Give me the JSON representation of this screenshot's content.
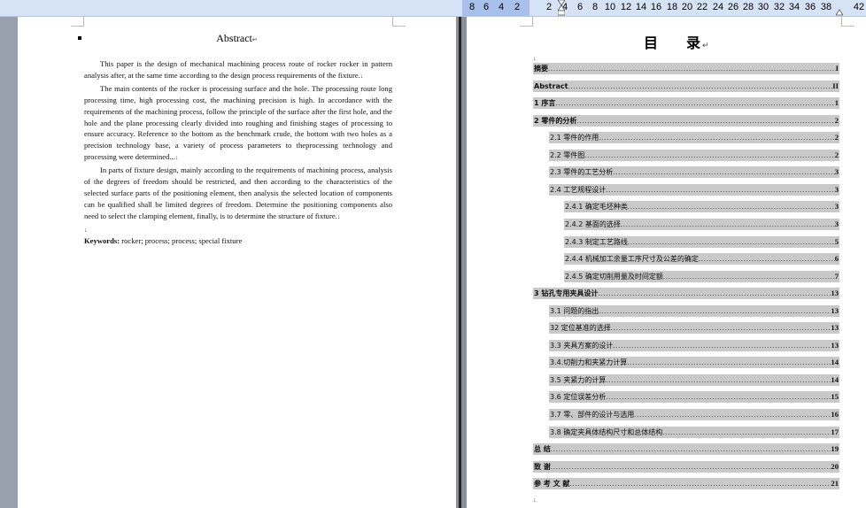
{
  "ruler": {
    "ticks": [
      "8",
      "6",
      "4",
      "2",
      "2",
      "4",
      "6",
      "8",
      "10",
      "12",
      "14",
      "16",
      "18",
      "20",
      "22",
      "24",
      "26",
      "28",
      "30",
      "32",
      "34",
      "36",
      "38",
      "42"
    ]
  },
  "abstract": {
    "title": "Abstract",
    "paragraphs": [
      "This paper is the design of mechanical machining process route of rocker rocker in pattern analysis after, at the same time according to the design process requirements of the fixture.",
      "The main contents of the rocker is processing surface and the hole. The processing route long processing time, high processing cost, the machining precision is high. In accordance with the requirements of the machining process, follow the principle of the surface after the first hole, and the hole and the plane processing clearly divided into roughing and finishing stages of processing to ensure accuracy. Reference to the bottom as the benchmark crude, the bottom with two holes as a precision technology base, a variety of process parameters to theprocessing technology and processing were determined...",
      "In parts of fixture design, mainly according to the requirements of machining process, analysis of the degrees of freedom should be restricted, and then according to the characteristics of the selected surface parts of the positioning element, then analysis the selected location of components can be qualified shall be limited degrees of freedom. Determine the positioning components also need to select the clamping element, finally, is to determine the structure of fixture."
    ],
    "keywords_label": "Keywords:",
    "keywords_value": " rocker; process; process; special fixture"
  },
  "toc": {
    "title_a": "目",
    "title_b": "录",
    "entries": [
      {
        "label": "摘要",
        "page": "I",
        "level": 0,
        "bold": true
      },
      {
        "label": "Abstract",
        "page": "II",
        "level": 0,
        "bold": true
      },
      {
        "label": "1 序言",
        "page": "1",
        "level": 0,
        "bold": true
      },
      {
        "label": "2 零件的分析",
        "page": "2",
        "level": 0,
        "bold": true
      },
      {
        "label": "2.1 零件的作用",
        "page": "2",
        "level": 1,
        "bold": false
      },
      {
        "label": "2.2 零件图",
        "page": "2",
        "level": 1,
        "bold": false
      },
      {
        "label": "2.3 零件的工艺分析",
        "page": "3",
        "level": 1,
        "bold": false
      },
      {
        "label": "2.4 工艺规程设计",
        "page": "3",
        "level": 1,
        "bold": false
      },
      {
        "label": "2.4.1 确定毛坯种类",
        "page": "3",
        "level": 2,
        "bold": false
      },
      {
        "label": "2.4.2 基面的选择",
        "page": "3",
        "level": 2,
        "bold": false
      },
      {
        "label": "2.4.3 制定工艺路线",
        "page": "5",
        "level": 2,
        "bold": false
      },
      {
        "label": "2.4.4 机械加工余量工序尺寸及公差的确定",
        "page": "6",
        "level": 2,
        "bold": false
      },
      {
        "label": "2.4.5 确定切削用量及时间定额",
        "page": "7",
        "level": 2,
        "bold": false
      },
      {
        "label": "3 钻孔专用夹具设计",
        "page": "13",
        "level": 0,
        "bold": true
      },
      {
        "label": "3.1 问题的指出",
        "page": "13",
        "level": 1,
        "bold": false
      },
      {
        "label": "32 定位基准的选择",
        "page": "13",
        "level": 1,
        "bold": false
      },
      {
        "label": "3.3 夹具方案的设计",
        "page": "13",
        "level": 1,
        "bold": false
      },
      {
        "label": "3.4.切削力和夹紧力计算",
        "page": "14",
        "level": 1,
        "bold": false
      },
      {
        "label": "3.5 夹紧力的计算",
        "page": "14",
        "level": 1,
        "bold": false
      },
      {
        "label": "3.6 定位误差分析",
        "page": "15",
        "level": 1,
        "bold": false
      },
      {
        "label": "3.7 零、部件的设计与选用",
        "page": "16",
        "level": 1,
        "bold": false
      },
      {
        "label": "3.8 确定夹具体结构尺寸和总体结构",
        "page": "17",
        "level": 1,
        "bold": false
      },
      {
        "label": "总    结",
        "page": "19",
        "level": 0,
        "bold": true
      },
      {
        "label": "致    谢",
        "page": "20",
        "level": 0,
        "bold": true
      },
      {
        "label": "参 考 文 献",
        "page": "21",
        "level": 0,
        "bold": true
      }
    ]
  }
}
